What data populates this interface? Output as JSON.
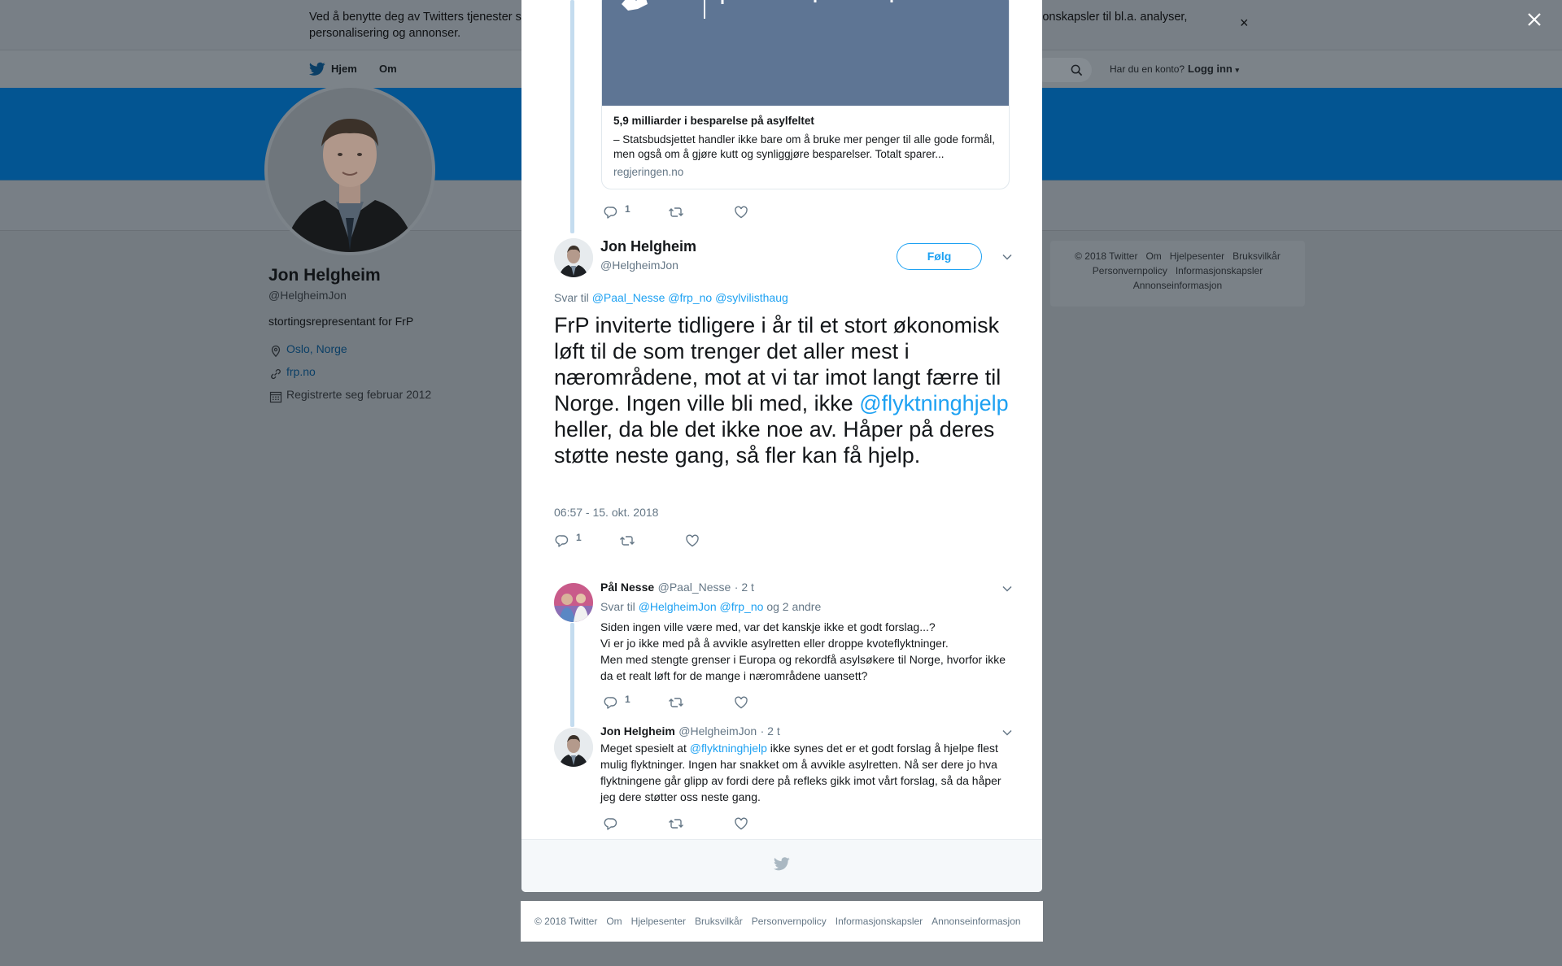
{
  "cookie_banner": {
    "text": "Ved å benytte deg av Twitters tjenester samtykker du i vår bruk av informasjonskapsler. Vi og våre partnere driver globalt og bruker informasjonskapsler til bl.a. analyser, personalisering og annonser.",
    "close_glyph": "×"
  },
  "topnav": {
    "home": "Hjem",
    "about": "Om",
    "has_account": "Har du en konto?",
    "login": "Logg inn"
  },
  "profile": {
    "name": "Jon Helgheim",
    "handle": "@HelgheimJon",
    "bio": "stortingsrepresentant for FrP",
    "location": "Oslo, Norge",
    "website": "frp.no",
    "joined": "Registrerte seg februar 2012"
  },
  "side_footer": {
    "items": [
      "© 2018 Twitter",
      "Om",
      "Hjelpesenter",
      "Bruksvilkår",
      "Personvernpolicy",
      "Informasjonskapsler",
      "Annonseinformasjon"
    ]
  },
  "card": {
    "image_text": "Regjeringen.no",
    "title": "5,9 milliarder i besparelse på asylfeltet",
    "description": "– Statsbudsjettet handler ikke bare om å bruke mer penger til alle gode formål, men også om å gjøre kutt og synliggjøre besparelser. Totalt sparer...",
    "domain": "regjeringen.no"
  },
  "prev_tweet_actions": {
    "replies": "1"
  },
  "main_tweet": {
    "name": "Jon Helgheim",
    "handle": "@HelgheimJon",
    "follow": "Følg",
    "reply_prefix": "Svar til",
    "reply_targets": [
      "@Paal_Nesse",
      "@frp_no",
      "@sylvilisthaug"
    ],
    "text_before": "FrP inviterte tidligere i år til et stort økonomisk løft til de som trenger det aller mest i nærområdene, mot at vi tar imot langt færre til Norge. Ingen ville bli med, ikke ",
    "mention": "@flyktninghjelp",
    "text_after": " heller, da ble det ikke noe av. Håper på deres støtte neste gang, så fler kan få hjelp.",
    "timestamp": "06:57 - 15. okt. 2018",
    "replies": "1"
  },
  "reply1": {
    "name": "Pål Nesse",
    "handle": "@Paal_Nesse",
    "time": "· 2 t",
    "reply_prefix": "Svar til",
    "reply_targets": [
      "@HelgheimJon",
      "@frp_no"
    ],
    "reply_suffix": "og 2 andre",
    "line1": "Siden ingen ville være med, var det kanskje ikke et godt forslag...?",
    "line2": "Vi er jo ikke med på å avvikle asylretten eller droppe kvoteflyktninger.",
    "line3": "Men med stengte grenser i Europa og rekordfå asylsøkere til Norge, hvorfor ikke da et realt løft for de mange i nærområdene uansett?",
    "replies": "1"
  },
  "reply2": {
    "name": "Jon Helgheim",
    "handle": "@HelgheimJon",
    "time": "· 2 t",
    "text_before": "Meget spesielt at ",
    "mention": "@flyktninghjelp",
    "text_after": " ikke synes det er et godt forslag å hjelpe flest mulig flyktninger. Ingen har snakket om å avvikle asylretten. Nå ser dere jo hva flyktningene går glipp av fordi dere på refleks gikk imot vårt forslag, så da håper jeg dere støtter oss neste gang."
  },
  "footer": {
    "items": [
      "© 2018 Twitter",
      "Om",
      "Hjelpesenter",
      "Bruksvilkår",
      "Personvernpolicy",
      "Informasjonskapsler",
      "Annonseinformasjon"
    ]
  },
  "colors": {
    "accent": "#1da1f2",
    "header_blue": "#035592",
    "overlay": "#747b81"
  }
}
